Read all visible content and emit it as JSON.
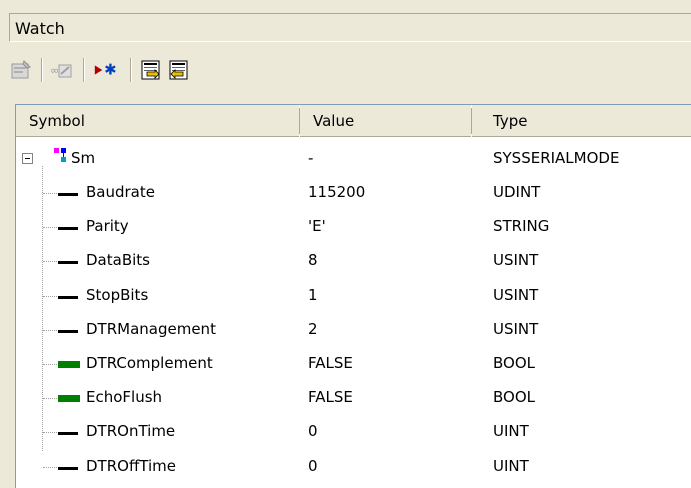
{
  "window": {
    "title": "Watch"
  },
  "toolbar": {
    "buttons": [
      {
        "name": "properties-icon"
      },
      {
        "name": "edit-icon"
      },
      {
        "name": "run-to-icon"
      },
      {
        "name": "import-icon"
      },
      {
        "name": "export-icon"
      }
    ]
  },
  "grid": {
    "columns": {
      "symbol": "Symbol",
      "value": "Value",
      "type": "Type"
    },
    "root": {
      "symbol": "Sm",
      "value": "-",
      "type": "SYSSERIALMODE"
    },
    "rows": [
      {
        "symbol": "Baudrate",
        "value": "115200",
        "type": "UDINT",
        "kind": "numeric"
      },
      {
        "symbol": "Parity",
        "value": "'E'",
        "type": "STRING",
        "kind": "numeric"
      },
      {
        "symbol": "DataBits",
        "value": "8",
        "type": "USINT",
        "kind": "numeric"
      },
      {
        "symbol": "StopBits",
        "value": "1",
        "type": "USINT",
        "kind": "numeric"
      },
      {
        "symbol": "DTRManagement",
        "value": "2",
        "type": "USINT",
        "kind": "numeric"
      },
      {
        "symbol": "DTRComplement",
        "value": "FALSE",
        "type": "BOOL",
        "kind": "bool"
      },
      {
        "symbol": "EchoFlush",
        "value": "FALSE",
        "type": "BOOL",
        "kind": "bool"
      },
      {
        "symbol": "DTROnTime",
        "value": "0",
        "type": "UINT",
        "kind": "numeric"
      },
      {
        "symbol": "DTROffTime",
        "value": "0",
        "type": "UINT",
        "kind": "numeric"
      }
    ]
  },
  "colors": {
    "bool_indicator": "#008000",
    "numeric_indicator": "#000000",
    "root_icon_pink": "#ff00ff",
    "root_icon_blue": "#0000ff",
    "root_icon_cyan": "#00a0c0"
  }
}
